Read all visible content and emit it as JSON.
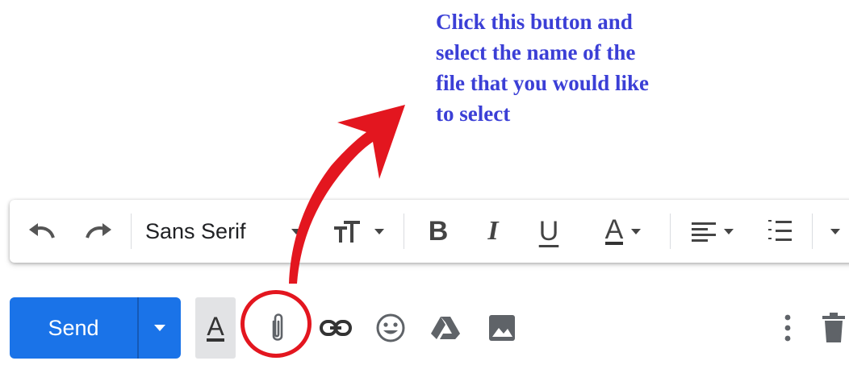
{
  "annotation": {
    "lines": [
      "Click this button and",
      "select the name of the",
      "file that you would like",
      "to select"
    ],
    "color": "#3b3fd6"
  },
  "format_toolbar": {
    "font_name": "Sans Serif",
    "bold_glyph": "B",
    "italic_glyph": "I",
    "underline_glyph": "U",
    "text_color_glyph": "A",
    "icons": [
      "undo-icon",
      "redo-icon",
      "text-size-icon",
      "align-icon",
      "numbered-list-icon"
    ]
  },
  "compose_bar": {
    "send_label": "Send",
    "format_glyph": "A",
    "icons": [
      "paperclip-icon",
      "link-icon",
      "emoji-icon",
      "drive-icon",
      "photo-icon",
      "more-vert-icon",
      "trash-icon"
    ]
  },
  "colors": {
    "send_blue": "#1a73e8",
    "annotation_red": "#e3161f"
  }
}
